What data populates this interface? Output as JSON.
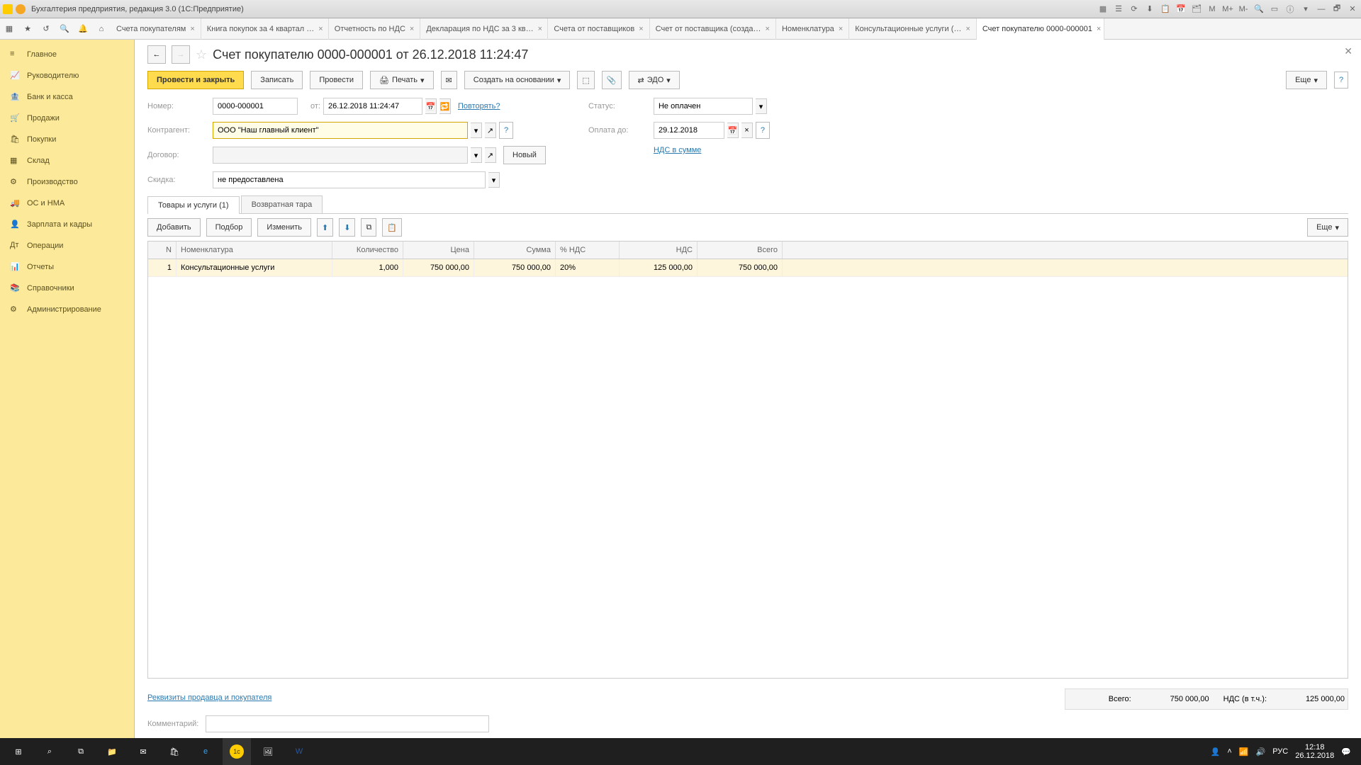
{
  "window": {
    "title": "Бухгалтерия предприятия, редакция 3.0  (1С:Предприятие)"
  },
  "tb_icons": [
    "▦",
    "☰",
    "⟳",
    "⬇",
    "📋",
    "📅",
    "🗂",
    "M",
    "M+",
    "M-",
    "🔍",
    "▭",
    "ⓘ",
    "▾",
    "—",
    "🗗",
    "✕"
  ],
  "toolbar_tools": [
    "▦",
    "★",
    "↺",
    "🔍",
    "🔔",
    "⌂"
  ],
  "tabs": [
    {
      "label": "Счета покупателям"
    },
    {
      "label": "Книга покупок за 4 квартал …"
    },
    {
      "label": "Отчетность по НДС"
    },
    {
      "label": "Декларация по НДС за 3 кв…"
    },
    {
      "label": "Счета от поставщиков"
    },
    {
      "label": "Счет от поставщика (созда…"
    },
    {
      "label": "Номенклатура"
    },
    {
      "label": "Консультационные услуги (…"
    },
    {
      "label": "Счет покупателю 0000-000001",
      "active": true
    }
  ],
  "sidebar": [
    {
      "label": "Главное",
      "ico": "≡"
    },
    {
      "label": "Руководителю",
      "ico": "📈"
    },
    {
      "label": "Банк и касса",
      "ico": "🏦"
    },
    {
      "label": "Продажи",
      "ico": "🛒"
    },
    {
      "label": "Покупки",
      "ico": "🛍"
    },
    {
      "label": "Склад",
      "ico": "▦"
    },
    {
      "label": "Производство",
      "ico": "⚙"
    },
    {
      "label": "ОС и НМА",
      "ico": "🚚"
    },
    {
      "label": "Зарплата и кадры",
      "ico": "👤"
    },
    {
      "label": "Операции",
      "ico": "Дт"
    },
    {
      "label": "Отчеты",
      "ico": "📊"
    },
    {
      "label": "Справочники",
      "ico": "📚"
    },
    {
      "label": "Администрирование",
      "ico": "⚙"
    }
  ],
  "page": {
    "title": "Счет покупателю 0000-000001 от 26.12.2018 11:24:47"
  },
  "cmd": {
    "post_close": "Провести и закрыть",
    "save": "Записать",
    "post": "Провести",
    "print": "Печать",
    "create_based": "Создать на основании",
    "edo": "ЭДО",
    "more": "Еще",
    "help": "?"
  },
  "form": {
    "number_lbl": "Номер:",
    "number": "0000-000001",
    "from_lbl": "от:",
    "date": "26.12.2018 11:24:47",
    "repeat": "Повторять?",
    "status_lbl": "Статус:",
    "status": "Не оплачен",
    "counterparty_lbl": "Контрагент:",
    "counterparty": "ООО \"Наш главный клиент\"",
    "payment_due_lbl": "Оплата до:",
    "payment_due": "29.12.2018",
    "contract_lbl": "Договор:",
    "contract": "",
    "new": "Новый",
    "vat_link": "НДС в сумме",
    "discount_lbl": "Скидка:",
    "discount": "не предоставлена"
  },
  "subtabs": [
    {
      "label": "Товары и услуги (1)",
      "active": true
    },
    {
      "label": "Возвратная тара"
    }
  ],
  "tblbar": {
    "add": "Добавить",
    "pick": "Подбор",
    "edit": "Изменить",
    "more": "Еще"
  },
  "cols": {
    "n": "N",
    "nom": "Номенклатура",
    "qty": "Количество",
    "price": "Цена",
    "sum": "Сумма",
    "vat": "% НДС",
    "nds": "НДС",
    "total": "Всего"
  },
  "rows": [
    {
      "n": "1",
      "nom": "Консультационные услуги",
      "qty": "1,000",
      "price": "750 000,00",
      "sum": "750 000,00",
      "vat": "20%",
      "nds": "125 000,00",
      "total": "750 000,00"
    }
  ],
  "seller_link": "Реквизиты продавца и покупателя",
  "totals": {
    "total_lbl": "Всего:",
    "total": "750 000,00",
    "nds_lbl": "НДС (в т.ч.):",
    "nds": "125 000,00"
  },
  "comment_lbl": "Комментарий:",
  "comment": "",
  "taskbar": {
    "lang": "РУС",
    "time": "12:18",
    "date": "26.12.2018"
  }
}
